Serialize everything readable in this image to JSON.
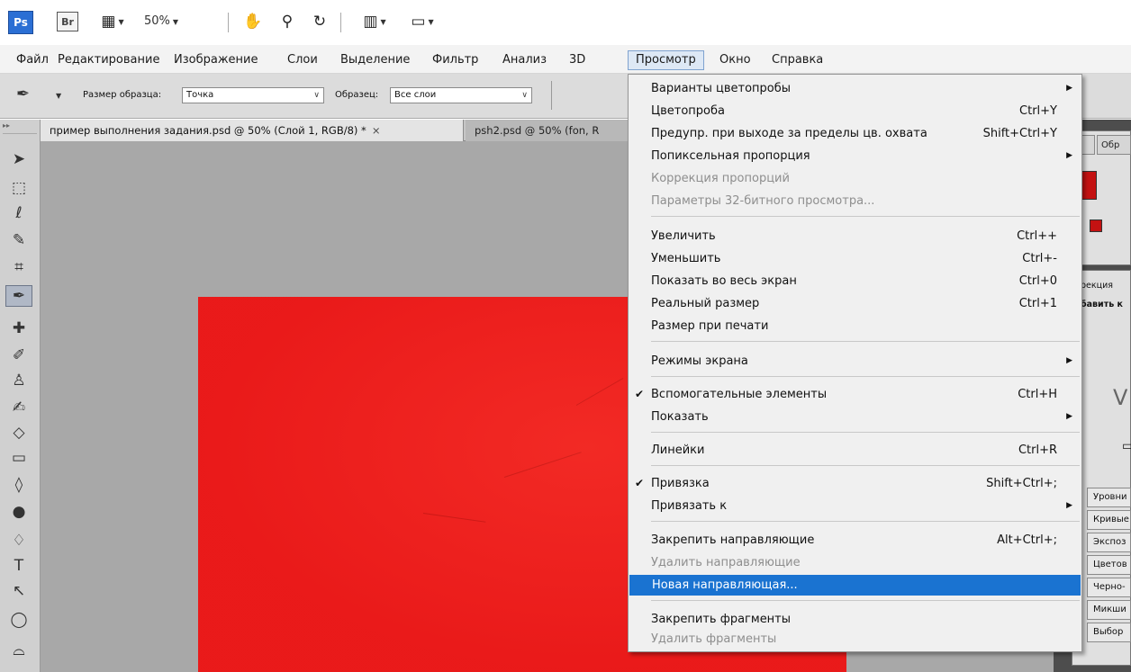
{
  "appbar": {
    "ps_logo": "Ps",
    "br_logo": "Br",
    "zoom": "50%"
  },
  "menubar": {
    "items": [
      "Файл",
      "Редактирование",
      "Изображение",
      "Слои",
      "Выделение",
      "Фильтр",
      "Анализ",
      "3D",
      "Просмотр",
      "Окно",
      "Справка"
    ],
    "active_index": 8
  },
  "options": {
    "sample_size_label": "Размер образца:",
    "sample_size_value": "Точка",
    "sample_label": "Образец:",
    "sample_value": "Все слои"
  },
  "tabs": [
    {
      "label": "пример выполнения задания.psd @ 50% (Слой 1, RGB/8) *",
      "close": "×",
      "active": true
    },
    {
      "label": "psh2.psd @ 50% (fon, R",
      "active": false
    }
  ],
  "right_panel": {
    "tab_partial_1": "т",
    "tab_partial_2": "Обр",
    "correction_label": "рекция",
    "add_label": "бавить к",
    "adjustments": [
      "Уровни",
      "Кривые",
      "Экспоз",
      "Цветов",
      "Черно-",
      "Микши",
      "Выбор"
    ]
  },
  "dropdown": {
    "items": [
      {
        "label": "Варианты цветопробы",
        "shortcut": "",
        "submenu": true,
        "checked": false,
        "disabled": false
      },
      {
        "label": "Цветопроба",
        "shortcut": "Ctrl+Y",
        "submenu": false,
        "checked": false,
        "disabled": false
      },
      {
        "label": "Предупр. при выходе за пределы цв. охвата",
        "shortcut": "Shift+Ctrl+Y",
        "submenu": false,
        "checked": false,
        "disabled": false
      },
      {
        "label": "Попиксельная пропорция",
        "shortcut": "",
        "submenu": true,
        "checked": false,
        "disabled": false
      },
      {
        "label": "Коррекция пропорций",
        "shortcut": "",
        "submenu": false,
        "checked": false,
        "disabled": true
      },
      {
        "label": "Параметры 32-битного просмотра...",
        "shortcut": "",
        "submenu": false,
        "checked": false,
        "disabled": true
      },
      {
        "label": "Увеличить",
        "shortcut": "Ctrl++",
        "submenu": false,
        "checked": false,
        "disabled": false
      },
      {
        "label": "Уменьшить",
        "shortcut": "Ctrl+-",
        "submenu": false,
        "checked": false,
        "disabled": false
      },
      {
        "label": "Показать во весь экран",
        "shortcut": "Ctrl+0",
        "submenu": false,
        "checked": false,
        "disabled": false
      },
      {
        "label": "Реальный размер",
        "shortcut": "Ctrl+1",
        "submenu": false,
        "checked": false,
        "disabled": false
      },
      {
        "label": "Размер при печати",
        "shortcut": "",
        "submenu": false,
        "checked": false,
        "disabled": false
      },
      {
        "label": "Режимы экрана",
        "shortcut": "",
        "submenu": true,
        "checked": false,
        "disabled": false
      },
      {
        "label": "Вспомогательные элементы",
        "shortcut": "Ctrl+H",
        "submenu": false,
        "checked": true,
        "disabled": false
      },
      {
        "label": "Показать",
        "shortcut": "",
        "submenu": true,
        "checked": false,
        "disabled": false
      },
      {
        "label": "Линейки",
        "shortcut": "Ctrl+R",
        "submenu": false,
        "checked": false,
        "disabled": false
      },
      {
        "label": "Привязка",
        "shortcut": "Shift+Ctrl+;",
        "submenu": false,
        "checked": true,
        "disabled": false
      },
      {
        "label": "Привязать к",
        "shortcut": "",
        "submenu": true,
        "checked": false,
        "disabled": false
      },
      {
        "label": "Закрепить направляющие",
        "shortcut": "Alt+Ctrl+;",
        "submenu": false,
        "checked": false,
        "disabled": false
      },
      {
        "label": "Удалить направляющие",
        "shortcut": "",
        "submenu": false,
        "checked": false,
        "disabled": true
      },
      {
        "label": "Новая направляющая...",
        "shortcut": "",
        "submenu": false,
        "checked": false,
        "disabled": false,
        "highlighted": true
      },
      {
        "label": "Закрепить фрагменты",
        "shortcut": "",
        "submenu": false,
        "checked": false,
        "disabled": false
      },
      {
        "label": "Удалить фрагменты",
        "shortcut": "",
        "submenu": false,
        "checked": false,
        "disabled": true
      }
    ],
    "check_glyph": "✔",
    "submenu_glyph": "▶"
  },
  "colors": {
    "highlight": "#1a73d1",
    "canvas": "#ee1d1d",
    "ps_blue": "#2b6fd4"
  }
}
